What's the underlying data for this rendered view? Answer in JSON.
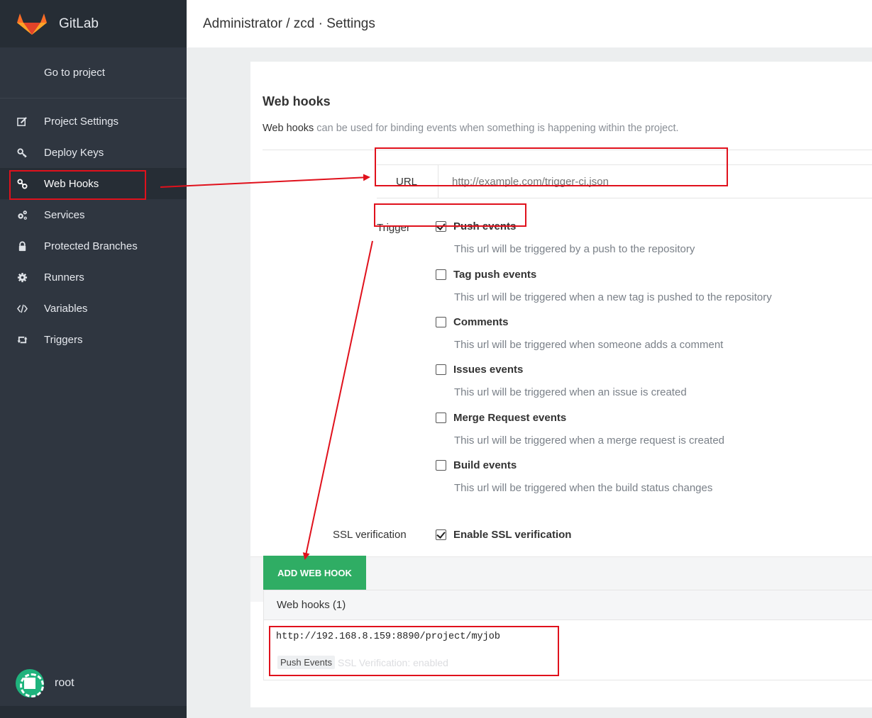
{
  "app": {
    "brand": "GitLab",
    "breadcrumb": "Administrator / zcd · Settings"
  },
  "sidebar": {
    "go_to_project": "Go to project",
    "items": [
      {
        "label": "Project Settings",
        "icon": "edit-icon",
        "active": false
      },
      {
        "label": "Deploy Keys",
        "icon": "key-icon",
        "active": false
      },
      {
        "label": "Web Hooks",
        "icon": "link-icon",
        "active": true
      },
      {
        "label": "Services",
        "icon": "cogs-icon",
        "active": false
      },
      {
        "label": "Protected Branches",
        "icon": "lock-icon",
        "active": false
      },
      {
        "label": "Runners",
        "icon": "gear-icon",
        "active": false
      },
      {
        "label": "Variables",
        "icon": "code-icon",
        "active": false
      },
      {
        "label": "Triggers",
        "icon": "retweet-icon",
        "active": false
      }
    ],
    "user": "root"
  },
  "webhooks": {
    "title": "Web hooks",
    "description_lead": "Web hooks",
    "description_rest": " can be used for binding events when something is happening within the project.",
    "url_label": "URL",
    "url_value": "",
    "url_placeholder": "http://example.com/trigger-ci.json",
    "trigger_label": "Trigger",
    "options": [
      {
        "title": "Push events",
        "help": "This url will be triggered by a push to the repository",
        "checked": true
      },
      {
        "title": "Tag push events",
        "help": "This url will be triggered when a new tag is pushed to the repository",
        "checked": false
      },
      {
        "title": "Comments",
        "help": "This url will be triggered when someone adds a comment",
        "checked": false
      },
      {
        "title": "Issues events",
        "help": "This url will be triggered when an issue is created",
        "checked": false
      },
      {
        "title": "Merge Request events",
        "help": "This url will be triggered when a merge request is created",
        "checked": false
      },
      {
        "title": "Build events",
        "help": "This url will be triggered when the build status changes",
        "checked": false
      }
    ],
    "ssl_label": "SSL verification",
    "ssl_option": "Enable SSL verification",
    "ssl_checked": true,
    "add_button": "ADD WEB HOOK",
    "list_header": "Web hooks (1)",
    "hooks": [
      {
        "url": "http://192.168.8.159:8890/project/myjob",
        "badge": "Push Events",
        "ssl_status": "SSL Verification: enabled"
      }
    ]
  },
  "colors": {
    "sidebar_bg": "#2f3640",
    "accent_green": "#2fad64",
    "annotation_red": "#e0111c"
  }
}
